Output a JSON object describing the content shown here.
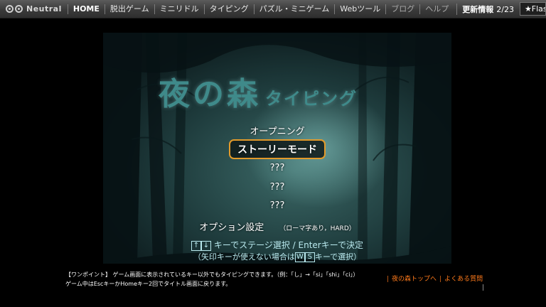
{
  "nav": {
    "logo_text": "Neutral",
    "items": [
      "HOME",
      "脱出ゲーム",
      "ミニリドル",
      "タイピング",
      "パズル・ミニゲーム",
      "Webツール",
      "ブログ",
      "ヘルプ"
    ],
    "update_label": "更新情報",
    "update_date": "2/23",
    "ticker": "★Flashの終了と"
  },
  "game": {
    "title_main": "夜の森",
    "title_sub": "タイピング",
    "menu": {
      "opening": "オープニング",
      "story": "ストーリーモード",
      "locked1": "???",
      "locked2": "???",
      "locked3": "???",
      "options": "オプション設定",
      "options_note": "（ローマ字あり，HARD）"
    },
    "hint": {
      "key_up": "↑",
      "key_down": "↓",
      "line1_a": "キーでステージ選択 / Enterキーで決定",
      "line2_a": "（矢印キーが使えない場合は",
      "key_w": "W",
      "key_s": "S",
      "line2_b": "キーで選択）"
    }
  },
  "footer": {
    "tip": "【ワンポイント】 ゲーム画面に表示されているキー以外でもタイピングできます。（例：「し」→「si」「shi」「ci」）",
    "home": "ゲーム中はEscキーかHomeキー2回でタイトル画面に戻ります。",
    "link_top": "夜の森トップへ",
    "link_faq": "よくある質問"
  },
  "colors": {
    "accent_border": "#e39a2a",
    "link": "#ff7a1a",
    "title": "#3f8a8a"
  }
}
